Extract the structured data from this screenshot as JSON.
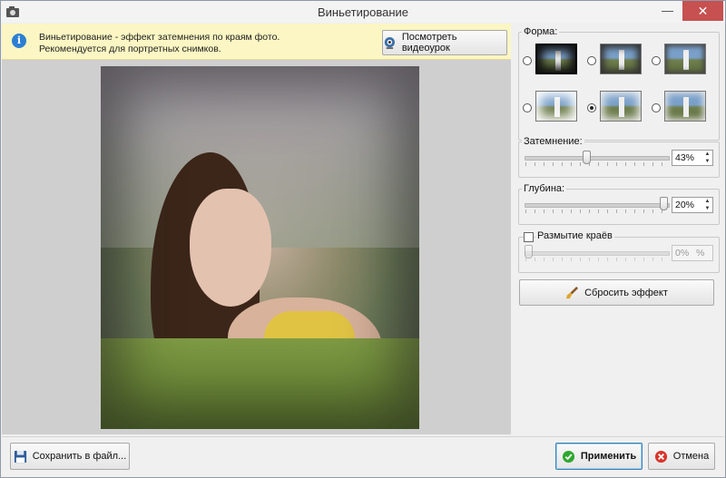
{
  "window": {
    "title": "Виньетирование",
    "minimize_glyph": "—",
    "close_glyph": "✕"
  },
  "info": {
    "line1": "Виньетирование - эффект затемнения по краям фото.",
    "line2": "Рекомендуется для портретных снимков.",
    "icon": "info-icon",
    "video_button": "Посмотреть видеоурок"
  },
  "panel": {
    "shape_label": "Форма:",
    "shapes_selected_index": 4,
    "darkening_label": "Затемнение:",
    "darkening_value": "43%",
    "darkening_level": 43,
    "depth_label": "Глубина:",
    "depth_value": "20%",
    "depth_level": 20,
    "blur_label": "Размытие краёв",
    "blur_checked": false,
    "blur_value": "0%",
    "reset_button": "Сбросить эффект"
  },
  "footer": {
    "save_button": "Сохранить в файл...",
    "apply_button": "Применить",
    "cancel_button": "Отмена"
  },
  "colors": {
    "info_bg": "#fbf6c3",
    "accent": "#3c7fb1",
    "apply_icon": "#2fa82f",
    "cancel_icon": "#d9342b"
  }
}
